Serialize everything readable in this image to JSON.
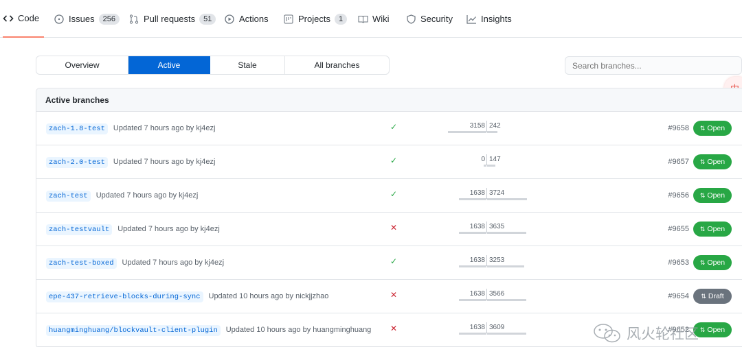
{
  "nav": {
    "tabs": [
      {
        "label": "Code",
        "icon": "code-icon",
        "counter": null,
        "selected": true
      },
      {
        "label": "Issues",
        "icon": "issue-icon",
        "counter": "256"
      },
      {
        "label": "Pull requests",
        "icon": "pull-request-icon",
        "counter": "51"
      },
      {
        "label": "Actions",
        "icon": "play-icon",
        "counter": null
      },
      {
        "label": "Projects",
        "icon": "project-icon",
        "counter": "1"
      },
      {
        "label": "Wiki",
        "icon": "book-icon",
        "counter": null
      },
      {
        "label": "Security",
        "icon": "shield-icon",
        "counter": null
      },
      {
        "label": "Insights",
        "icon": "graph-icon",
        "counter": null
      }
    ]
  },
  "filter": {
    "items": [
      "Overview",
      "Active",
      "Stale",
      "All branches"
    ],
    "active": "Active",
    "search_placeholder": "Search branches..."
  },
  "ime_indicator": "中",
  "branches": {
    "header": "Active branches",
    "rows": [
      {
        "name": "zach-1.8-test",
        "updated": "Updated 7 hours ago by kj4ezj",
        "status": "success",
        "behind": "3158",
        "ahead": "242",
        "pr": "#9658",
        "pr_state": "Open"
      },
      {
        "name": "zach-2.0-test",
        "updated": "Updated 7 hours ago by kj4ezj",
        "status": "success",
        "behind": "0",
        "ahead": "147",
        "pr": "#9657",
        "pr_state": "Open"
      },
      {
        "name": "zach-test",
        "updated": "Updated 7 hours ago by kj4ezj",
        "status": "success",
        "behind": "1638",
        "ahead": "3724",
        "pr": "#9656",
        "pr_state": "Open"
      },
      {
        "name": "zach-testvault",
        "updated": "Updated 7 hours ago by kj4ezj",
        "status": "failure",
        "behind": "1638",
        "ahead": "3635",
        "pr": "#9655",
        "pr_state": "Open"
      },
      {
        "name": "zach-test-boxed",
        "updated": "Updated 7 hours ago by kj4ezj",
        "status": "success",
        "behind": "1638",
        "ahead": "3253",
        "pr": "#9653",
        "pr_state": "Open"
      },
      {
        "name": "epe-437-retrieve-blocks-during-sync",
        "updated": "Updated 10 hours ago by nickjjzhao",
        "status": "failure",
        "behind": "1638",
        "ahead": "3566",
        "pr": "#9654",
        "pr_state": "Draft"
      },
      {
        "name": "huangminghuang/blockvault-client-plugin",
        "updated": "Updated 10 hours ago by huangminghuang",
        "status": "failure",
        "behind": "1638",
        "ahead": "3609",
        "pr": "#9652",
        "pr_state": "Open"
      }
    ]
  },
  "watermark": "风火轮社区",
  "colors": {
    "accent": "#0366d6",
    "open": "#28a745",
    "draft": "#6a737d",
    "fail": "#cb2431",
    "tab_underline": "#f9826c"
  }
}
